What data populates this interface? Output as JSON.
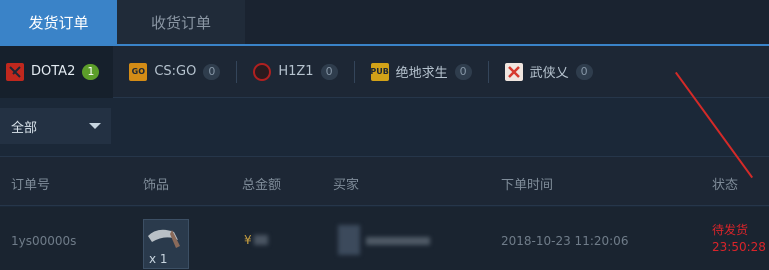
{
  "top_tabs": [
    {
      "label": "发货订单",
      "active": true
    },
    {
      "label": "收货订单",
      "active": false
    }
  ],
  "games": [
    {
      "label": "DOTA2",
      "count": "1",
      "active": true,
      "icon": "dota2-icon",
      "color": "#c0281e"
    },
    {
      "label": "CS:GO",
      "count": "0",
      "active": false,
      "icon": "csgo-icon",
      "color": "#d48c16"
    },
    {
      "label": "H1Z1",
      "count": "0",
      "active": false,
      "icon": "h1z1-icon",
      "color": "#b02020"
    },
    {
      "label": "绝地求生",
      "count": "0",
      "active": false,
      "icon": "pubg-icon",
      "color": "#d2a218"
    },
    {
      "label": "武侠乂",
      "count": "0",
      "active": false,
      "icon": "wuxia-icon",
      "color": "#d63a2f"
    }
  ],
  "filter": {
    "selected": "全部"
  },
  "table": {
    "headers": [
      "订单号",
      "饰品",
      "总金额",
      "买家",
      "下单时间",
      "状态"
    ],
    "rows": [
      {
        "order_id": "1ys00000s",
        "item_qty": "x 1",
        "amount_symbol": "¥",
        "time": "2018-10-23 11:20:06",
        "status_line1": "待发货",
        "status_line2": "23:50:28"
      }
    ]
  },
  "colors": {
    "accent": "#3a83c8",
    "badge_green": "#5c9e2a",
    "status_red": "#d9242a",
    "arrow_red": "#d42a28"
  }
}
